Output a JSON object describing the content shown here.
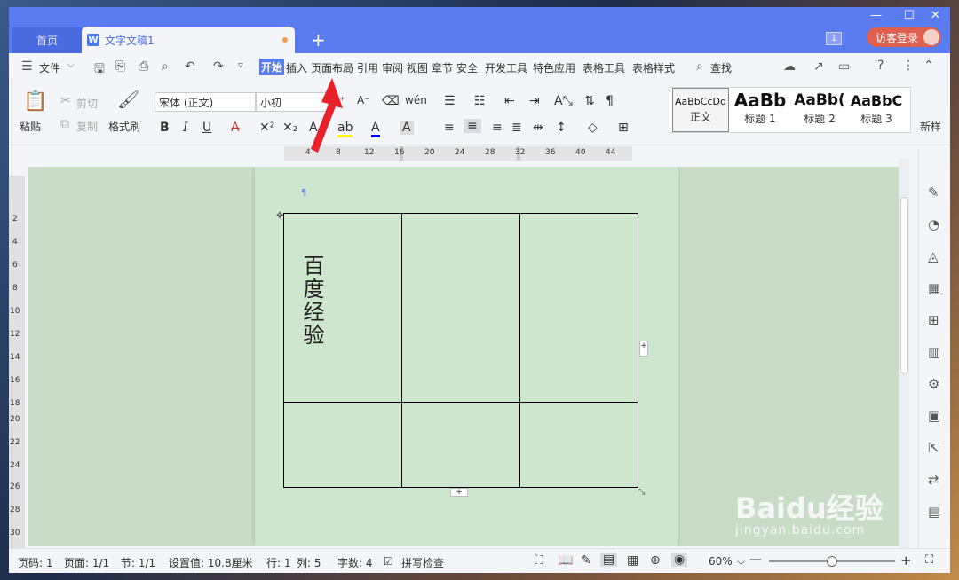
{
  "tabs": {
    "home": "首页",
    "doc_title": "文字文稿1",
    "add": "+"
  },
  "window": {
    "min": "—",
    "max": "☐",
    "close": "✕",
    "badge": "1",
    "login": "访客登录"
  },
  "menu": {
    "file": "文件",
    "items": [
      "开始",
      "插入",
      "页面布局",
      "引用",
      "审阅",
      "视图",
      "章节",
      "安全",
      "开发工具",
      "特色应用",
      "表格工具",
      "表格样式"
    ],
    "active": "开始",
    "search": "查找"
  },
  "ribbon": {
    "paste": "粘贴",
    "cut": "剪切",
    "copy": "复制",
    "format_painter": "格式刷",
    "font": "宋体 (正文)",
    "size": "小初",
    "bold": "B",
    "italic": "I",
    "underline": "U",
    "styles": [
      {
        "preview": "AaBbCcDd",
        "label": "正文"
      },
      {
        "preview": "AaBb",
        "label": "标题 1"
      },
      {
        "preview": "AaBb(",
        "label": "标题 2"
      },
      {
        "preview": "AaBbC",
        "label": "标题 3"
      }
    ],
    "new_style": "新样"
  },
  "ruler": {
    "h_ticks": [
      "4",
      "8",
      "12",
      "16",
      "20",
      "24",
      "28",
      "32",
      "36",
      "40",
      "44"
    ],
    "v_ticks": [
      "2",
      "4",
      "6",
      "8",
      "10",
      "12",
      "14",
      "16",
      "18",
      "20",
      "22",
      "24",
      "26",
      "28",
      "30"
    ]
  },
  "document": {
    "cell_text": "百度经验"
  },
  "status": {
    "page_no": "页码: 1",
    "pages": "页面: 1/1",
    "section": "节: 1/1",
    "setting": "设置值: 10.8厘米",
    "row": "行: 1",
    "col": "列: 5",
    "words": "字数: 4",
    "spell": "拼写检查",
    "zoom": "60%",
    "zoom_level": 0.5
  },
  "watermark": {
    "brand": "Baidu经验",
    "url": "jingyan.baidu.com"
  },
  "colors": {
    "titlebar": "#5b7bf0",
    "page": "#cde6cd",
    "workspace": "#c8dcc8",
    "arrow": "#e8202a",
    "login": "#e06050"
  }
}
